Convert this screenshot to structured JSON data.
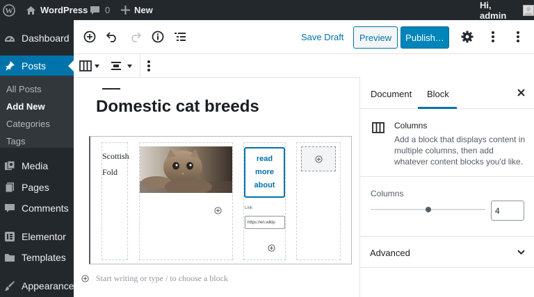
{
  "admin_bar": {
    "site_name": "WordPress",
    "comments_count": "0",
    "new_label": "New",
    "greeting": "Hi, admin"
  },
  "sidebar": {
    "dashboard": "Dashboard",
    "posts": "Posts",
    "submenu": [
      "All Posts",
      "Add New",
      "Categories",
      "Tags"
    ],
    "media": "Media",
    "pages": "Pages",
    "comments": "Comments",
    "elementor": "Elementor",
    "templates": "Templates",
    "appearance": "Appearance"
  },
  "header": {
    "save_draft": "Save Draft",
    "preview": "Preview",
    "publish": "Publish…"
  },
  "editor": {
    "post_title": "Domestic cat breeds",
    "col1_text_line1": "Scottish",
    "col1_text_line2": "Fold",
    "button_line1": "read",
    "button_line2": "more",
    "button_line3": "about",
    "link_label": "Link",
    "link_value": "https://en.wikip",
    "appender_placeholder": "Start writing or type / to choose a block"
  },
  "panel": {
    "tab_document": "Document",
    "tab_block": "Block",
    "block_name": "Columns",
    "block_description": "Add a block that displays content in multiple columns, then add whatever content blocks you'd like.",
    "columns_label": "Columns",
    "columns_value": "4",
    "columns_slider_fraction": 0.5,
    "advanced_label": "Advanced"
  },
  "colors": {
    "admin_dark": "#23282d",
    "submenu_bg": "#32373c",
    "accent_blue": "#0073aa",
    "publish_blue": "#0085ba"
  }
}
